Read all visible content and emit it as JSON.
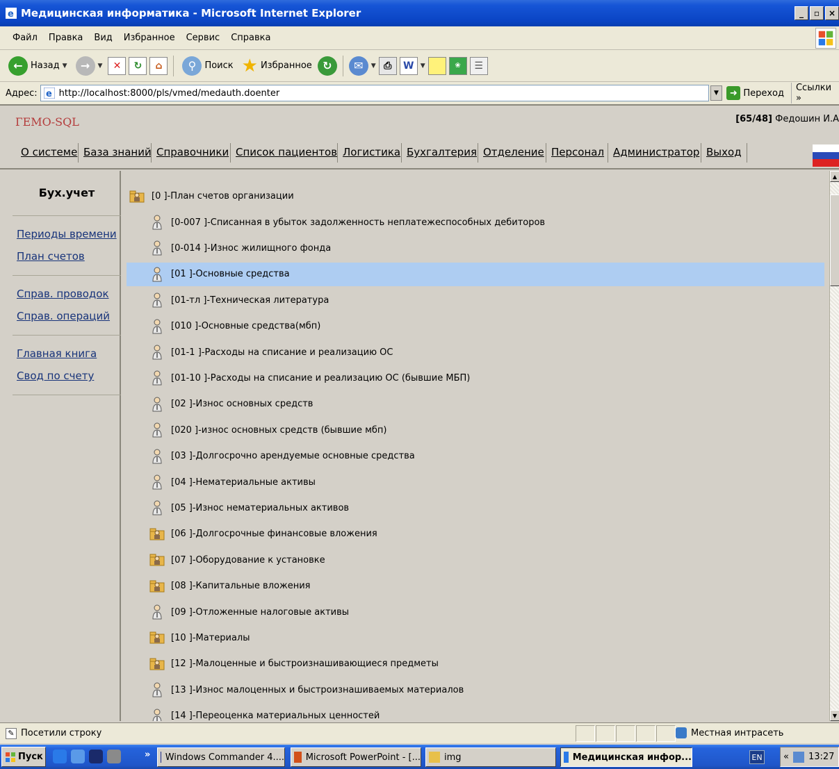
{
  "window": {
    "title": "Медицинская информатика - Microsoft Internet Explorer",
    "controls": [
      "_",
      "▫",
      "×"
    ]
  },
  "menu": {
    "items": [
      "Файл",
      "Правка",
      "Вид",
      "Избранное",
      "Сервис",
      "Справка"
    ]
  },
  "toolbar": {
    "back_label": "Назад",
    "search_label": "Поиск",
    "favorites_label": "Избранное"
  },
  "address": {
    "label": "Адрес:",
    "url": "http://localhost:8000/pls/vmed/medauth.doenter",
    "go_label": "Переход",
    "links_label": "Ссылки »"
  },
  "app": {
    "brand": "ГЕМО-SQL",
    "user_counter": "[65/48]",
    "user_name": "Федошин И.А"
  },
  "nav": {
    "items": [
      "О системе",
      "База знаний",
      "Справочники",
      "Список пациентов",
      "Логистика",
      "Бухгалтерия",
      "Отделение",
      "Персонал",
      "Администратор",
      "Выход"
    ]
  },
  "sidebar": {
    "title": "Бух.учет",
    "links": [
      "Периоды времени",
      "План счетов",
      "Справ. проводок",
      "Справ. операций",
      "Главная книга",
      "Свод по счету"
    ]
  },
  "tree": {
    "root": "[0 ]-План счетов организации",
    "selected_index": 2,
    "items": [
      {
        "text": "[0-007 ]-Списанная в убыток задолженность неплатежеспособных дебиторов",
        "icon": "person-icon"
      },
      {
        "text": "[0-014 ]-Износ жилищного фонда",
        "icon": "person-icon"
      },
      {
        "text": "[01 ]-Основные средства",
        "icon": "person-icon"
      },
      {
        "text": "[01-тл ]-Техническая литература",
        "icon": "person-icon"
      },
      {
        "text": "[010 ]-Основные средства(мбп)",
        "icon": "person-icon"
      },
      {
        "text": "[01-1 ]-Расходы на списание и реализацию ОС",
        "icon": "person-icon"
      },
      {
        "text": "[01-10 ]-Расходы на списание и реализацию ОС (бывшие МБП)",
        "icon": "person-icon"
      },
      {
        "text": "[02 ]-Износ основных средств",
        "icon": "person-icon"
      },
      {
        "text": "[020 ]-износ основных средств (бывшие мбп)",
        "icon": "person-icon"
      },
      {
        "text": "[03 ]-Долгосрочно арендуемые основные средства",
        "icon": "person-icon"
      },
      {
        "text": "[04 ]-Нематериальные активы",
        "icon": "person-icon"
      },
      {
        "text": "[05 ]-Износ нематериальных активов",
        "icon": "person-icon"
      },
      {
        "text": "[06 ]-Долгосрочные финансовые вложения",
        "icon": "group-folder-icon"
      },
      {
        "text": "[07 ]-Оборудование к установке",
        "icon": "group-folder-icon"
      },
      {
        "text": "[08 ]-Капитальные вложения",
        "icon": "group-folder-icon"
      },
      {
        "text": "[09 ]-Отложенные налоговые активы",
        "icon": "person-icon"
      },
      {
        "text": "[10 ]-Материалы",
        "icon": "group-folder-icon"
      },
      {
        "text": "[12 ]-Малоценные и быстроизнашивающиеся предметы",
        "icon": "group-folder-icon"
      },
      {
        "text": "[13 ]-Износ малоценных и быстроизнашиваемых материалов",
        "icon": "person-icon"
      },
      {
        "text": "[14 ]-Переоценка материальных ценностей",
        "icon": "person-icon"
      }
    ]
  },
  "status": {
    "text": "Посетили строку",
    "zone": "Местная интрасеть"
  },
  "taskbar": {
    "start_label": "Пуск",
    "tasks": [
      "Windows Commander 4....",
      "Microsoft PowerPoint - [...",
      "img",
      "Медицинская инфор..."
    ],
    "lang": "EN",
    "clock": "13:27"
  }
}
